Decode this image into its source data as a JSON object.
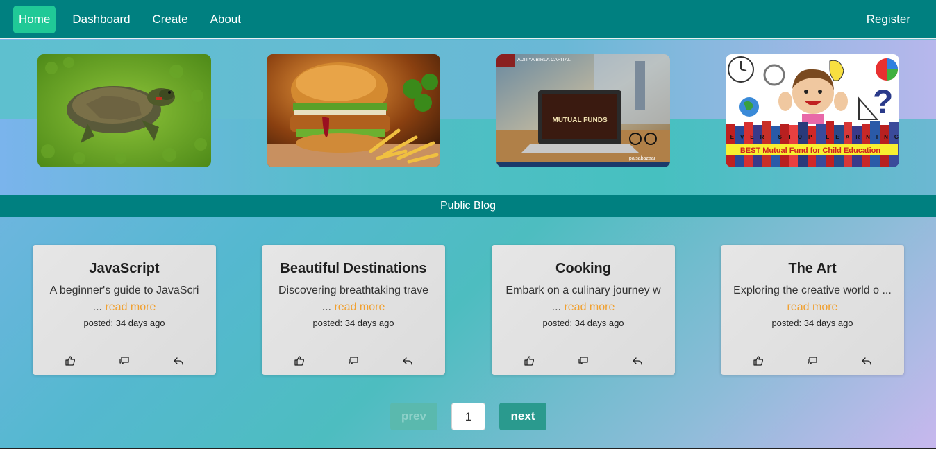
{
  "nav": {
    "items": [
      {
        "label": "Home",
        "active": true
      },
      {
        "label": "Dashboard"
      },
      {
        "label": "Create"
      },
      {
        "label": "About"
      }
    ],
    "register_label": "Register"
  },
  "hero": {
    "images": [
      {
        "subject": "turtle"
      },
      {
        "subject": "burger"
      },
      {
        "subject": "mutual-funds",
        "caption": "MUTUAL FUNDS",
        "brand_top": "ADITYA BIRLA CAPITAL",
        "brand_bottom": "paisabazaar"
      },
      {
        "subject": "child-education",
        "caption_top": "NEVER STOP LEARNING",
        "caption": "BEST Mutual Fund for Child Education"
      }
    ]
  },
  "section": {
    "title": "Public Blog"
  },
  "cards": [
    {
      "title": "JavaScript",
      "excerpt": "A beginner's guide to JavaScri ...",
      "read_more": "read more",
      "date": "posted: 34 days ago"
    },
    {
      "title": "Beautiful Destinations",
      "excerpt": "Discovering breathtaking trave ...",
      "read_more": "read more",
      "date": "posted: 34 days ago"
    },
    {
      "title": "Cooking",
      "excerpt": "Embark on a culinary journey w ...",
      "read_more": "read more",
      "date": "posted: 34 days ago"
    },
    {
      "title": "The Art",
      "excerpt": "Exploring the creative world o ...",
      "read_more": "read more",
      "date": "posted: 34 days ago"
    }
  ],
  "card_actions": [
    {
      "icon": "thumbs-up-icon"
    },
    {
      "icon": "comment-icon"
    },
    {
      "icon": "reply-icon"
    }
  ],
  "pagination": {
    "prev": "prev",
    "page": "1",
    "next": "next"
  },
  "colors": {
    "navbar": "#008080",
    "active": "#20c997",
    "read_more": "#f0a030"
  }
}
